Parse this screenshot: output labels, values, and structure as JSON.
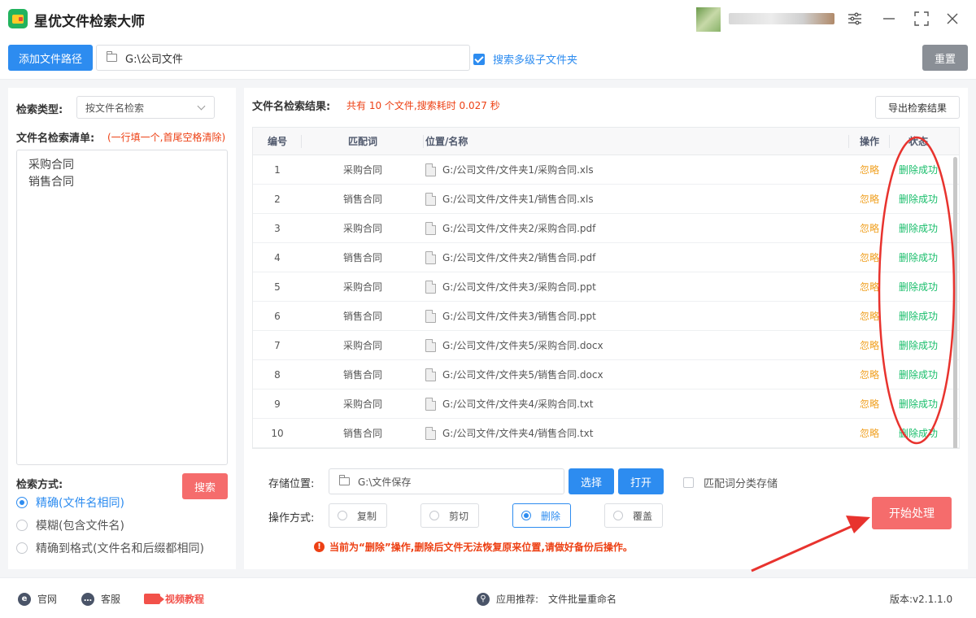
{
  "app": {
    "title": "星优文件检索大师"
  },
  "toolbar": {
    "add_path_label": "添加文件路径",
    "path_value": "G:\\公司文件",
    "subfolder_label": "搜索多级子文件夹",
    "subfolder_checked": true,
    "reset_label": "重置"
  },
  "left": {
    "search_type_label": "检索类型:",
    "search_type_value": "按文件名检索",
    "list_label": "文件名检索清单:",
    "list_hint": "(一行填一个,首尾空格清除)",
    "list_items": [
      "采购合同",
      "销售合同"
    ],
    "method_label": "检索方式:",
    "search_button": "搜索",
    "methods": [
      {
        "label": "精确(文件名相同)",
        "selected": true
      },
      {
        "label": "模糊(包含文件名)",
        "selected": false
      },
      {
        "label": "精确到格式(文件名和后缀都相同)",
        "selected": false
      }
    ]
  },
  "results": {
    "label": "文件名检索结果:",
    "summary": "共有 10 个文件,搜索耗时 0.027 秒",
    "export_label": "导出检索结果",
    "columns": [
      "编号",
      "匹配词",
      "位置/名称",
      "操作",
      "状态"
    ],
    "rows": [
      {
        "no": "1",
        "keyword": "采购合同",
        "path": "G:/公司文件/文件夹1/采购合同.xls",
        "op": "忽略",
        "status": "删除成功"
      },
      {
        "no": "2",
        "keyword": "销售合同",
        "path": "G:/公司文件/文件夹1/销售合同.xls",
        "op": "忽略",
        "status": "删除成功"
      },
      {
        "no": "3",
        "keyword": "采购合同",
        "path": "G:/公司文件/文件夹2/采购合同.pdf",
        "op": "忽略",
        "status": "删除成功"
      },
      {
        "no": "4",
        "keyword": "销售合同",
        "path": "G:/公司文件/文件夹2/销售合同.pdf",
        "op": "忽略",
        "status": "删除成功"
      },
      {
        "no": "5",
        "keyword": "采购合同",
        "path": "G:/公司文件/文件夹3/采购合同.ppt",
        "op": "忽略",
        "status": "删除成功"
      },
      {
        "no": "6",
        "keyword": "销售合同",
        "path": "G:/公司文件/文件夹3/销售合同.ppt",
        "op": "忽略",
        "status": "删除成功"
      },
      {
        "no": "7",
        "keyword": "采购合同",
        "path": "G:/公司文件/文件夹5/采购合同.docx",
        "op": "忽略",
        "status": "删除成功"
      },
      {
        "no": "8",
        "keyword": "销售合同",
        "path": "G:/公司文件/文件夹5/销售合同.docx",
        "op": "忽略",
        "status": "删除成功"
      },
      {
        "no": "9",
        "keyword": "采购合同",
        "path": "G:/公司文件/文件夹4/采购合同.txt",
        "op": "忽略",
        "status": "删除成功"
      },
      {
        "no": "10",
        "keyword": "销售合同",
        "path": "G:/公司文件/文件夹4/销售合同.txt",
        "op": "忽略",
        "status": "删除成功"
      }
    ]
  },
  "output": {
    "store_label": "存储位置:",
    "store_value": "G:\\文件保存",
    "choose_label": "选择",
    "open_label": "打开",
    "classify_label": "匹配词分类存储",
    "classify_checked": false,
    "op_label": "操作方式:",
    "ops": [
      {
        "label": "复制",
        "selected": false
      },
      {
        "label": "剪切",
        "selected": false
      },
      {
        "label": "删除",
        "selected": true
      },
      {
        "label": "覆盖",
        "selected": false
      }
    ],
    "warning": "当前为“删除”操作,删除后文件无法恢复原来位置,请做好备份后操作。",
    "start_label": "开始处理"
  },
  "footer": {
    "website": "官网",
    "support": "客服",
    "video": "视频教程",
    "recommend_label": "应用推荐:",
    "recommend_value": "文件批量重命名",
    "version": "版本:v2.1.1.0"
  },
  "colors": {
    "primary": "#2d8cf0",
    "danger": "#f56c6c",
    "warning_text": "#ed4014",
    "ignore": "#f0a020",
    "success": "#19be6b",
    "annotation": "#e8332e"
  },
  "icons": {
    "window": [
      "settings-sliders-icon",
      "minimize-icon",
      "maximize-icon",
      "close-icon"
    ],
    "footer": [
      "ie-icon",
      "chat-icon",
      "video-icon",
      "link-icon"
    ]
  }
}
